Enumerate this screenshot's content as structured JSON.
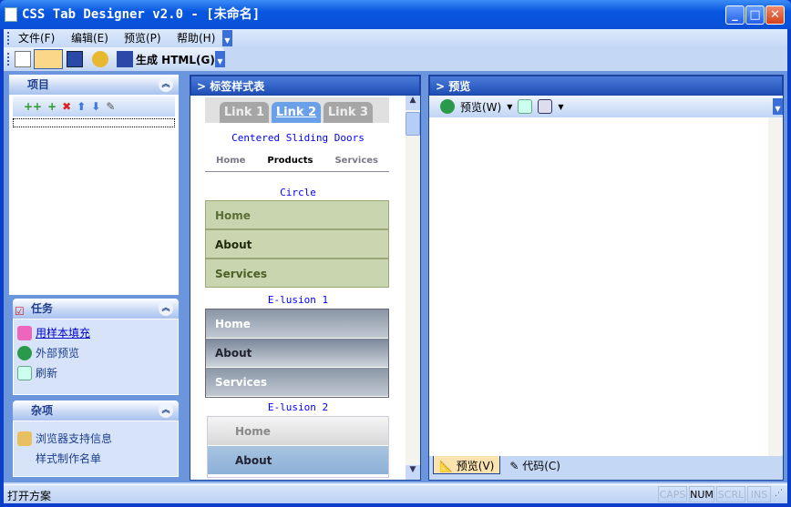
{
  "window": {
    "title": "CSS Tab Designer v2.0 - [未命名]",
    "min": "_",
    "max": "□",
    "close": "✕"
  },
  "menu": [
    "文件(F)",
    "编辑(E)",
    "预览(P)",
    "帮助(H)"
  ],
  "toolbar": {
    "generate": "生成 HTML(G)"
  },
  "left": {
    "project": {
      "title": "项目"
    },
    "tasks": {
      "title": "任务",
      "items": [
        "用样本填充",
        "外部预览",
        "刷新"
      ]
    },
    "misc": {
      "title": "杂项",
      "items": [
        "浏览器支持信息",
        "样式制作名单"
      ]
    }
  },
  "middle": {
    "title": "> 标签样式表",
    "tabs": [
      "Link 1",
      "Link 2",
      "Link 3"
    ],
    "styles": [
      {
        "name": "Centered Sliding Doors",
        "items": [
          "Home",
          "Products",
          "Services"
        ]
      },
      {
        "name": "Circle",
        "items": [
          "Home",
          "About",
          "Services"
        ]
      },
      {
        "name": "E-lusion 1",
        "items": [
          "Home",
          "About",
          "Services"
        ]
      },
      {
        "name": "E-lusion 2",
        "items": [
          "Home",
          "About"
        ]
      }
    ]
  },
  "right": {
    "title": "> 预览",
    "preview_btn": "预览(W)",
    "tabs": [
      "预览(V)",
      "代码(C)"
    ]
  },
  "statusbar": {
    "text": "打开方案",
    "indicators": [
      "CAPS",
      "NUM",
      "SCRL",
      "INS"
    ]
  }
}
